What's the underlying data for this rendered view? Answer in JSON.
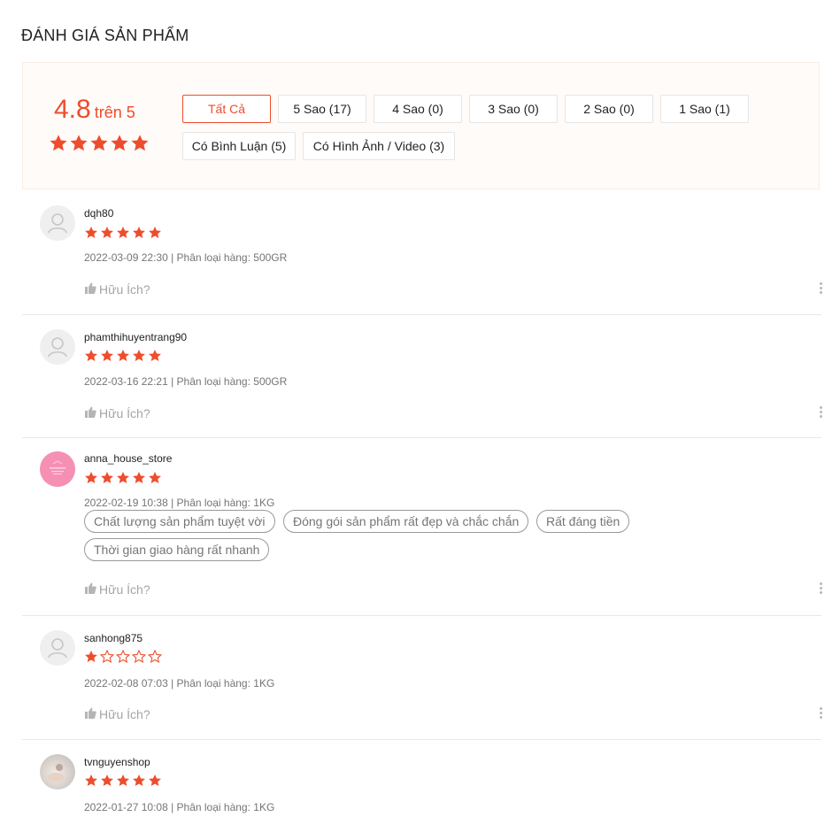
{
  "header": {
    "title": "ĐÁNH GIÁ SẢN PHẨM"
  },
  "summary": {
    "score": "4.8",
    "score_suffix": "trên 5",
    "stars": 5
  },
  "filters": [
    {
      "label": "Tất Cả",
      "active": true
    },
    {
      "label": "5 Sao (17)",
      "active": false
    },
    {
      "label": "4 Sao (0)",
      "active": false
    },
    {
      "label": "3 Sao (0)",
      "active": false
    },
    {
      "label": "2 Sao (0)",
      "active": false
    },
    {
      "label": "1 Sao (1)",
      "active": false
    },
    {
      "label": "Có Bình Luận (5)",
      "active": false
    },
    {
      "label": "Có Hình Ảnh / Video (3)",
      "active": false
    }
  ],
  "reviews": [
    {
      "username": "dqh80",
      "rating": 5,
      "meta": "2022-03-09 22:30 | Phân loại hàng: 500GR",
      "helpful": "Hữu Ích?",
      "avatar": "default-avatar-icon",
      "tags": []
    },
    {
      "username": "phamthihuyentrang90",
      "rating": 5,
      "meta": "2022-03-16 22:21 | Phân loại hàng: 500GR",
      "helpful": "Hữu Ích?",
      "avatar": "default-avatar-icon",
      "tags": []
    },
    {
      "username": "anna_house_store",
      "rating": 5,
      "meta": "2022-02-19 10:38 | Phân loại hàng: 1KG",
      "helpful": "Hữu Ích?",
      "avatar": "pink-store-avatar",
      "tags": [
        "Chất lượng sản phẩm tuyệt vời",
        "Đóng gói sản phẩm rất đẹp và chắc chắn",
        "Rất đáng tiền",
        "Thời gian giao hàng rất nhanh"
      ]
    },
    {
      "username": "sanhong875",
      "rating": 1,
      "meta": "2022-02-08 07:03 | Phân loại hàng: 1KG",
      "helpful": "Hữu Ích?",
      "avatar": "default-avatar-icon",
      "tags": []
    },
    {
      "username": "tvnguyenshop",
      "rating": 5,
      "meta": "2022-01-27 10:08 | Phân loại hàng: 1KG",
      "helpful": "",
      "avatar": "photo-avatar",
      "tags": []
    }
  ],
  "colors": {
    "accent": "#ee4d2d",
    "overview_bg": "#fffbf8",
    "muted": "#757575"
  }
}
